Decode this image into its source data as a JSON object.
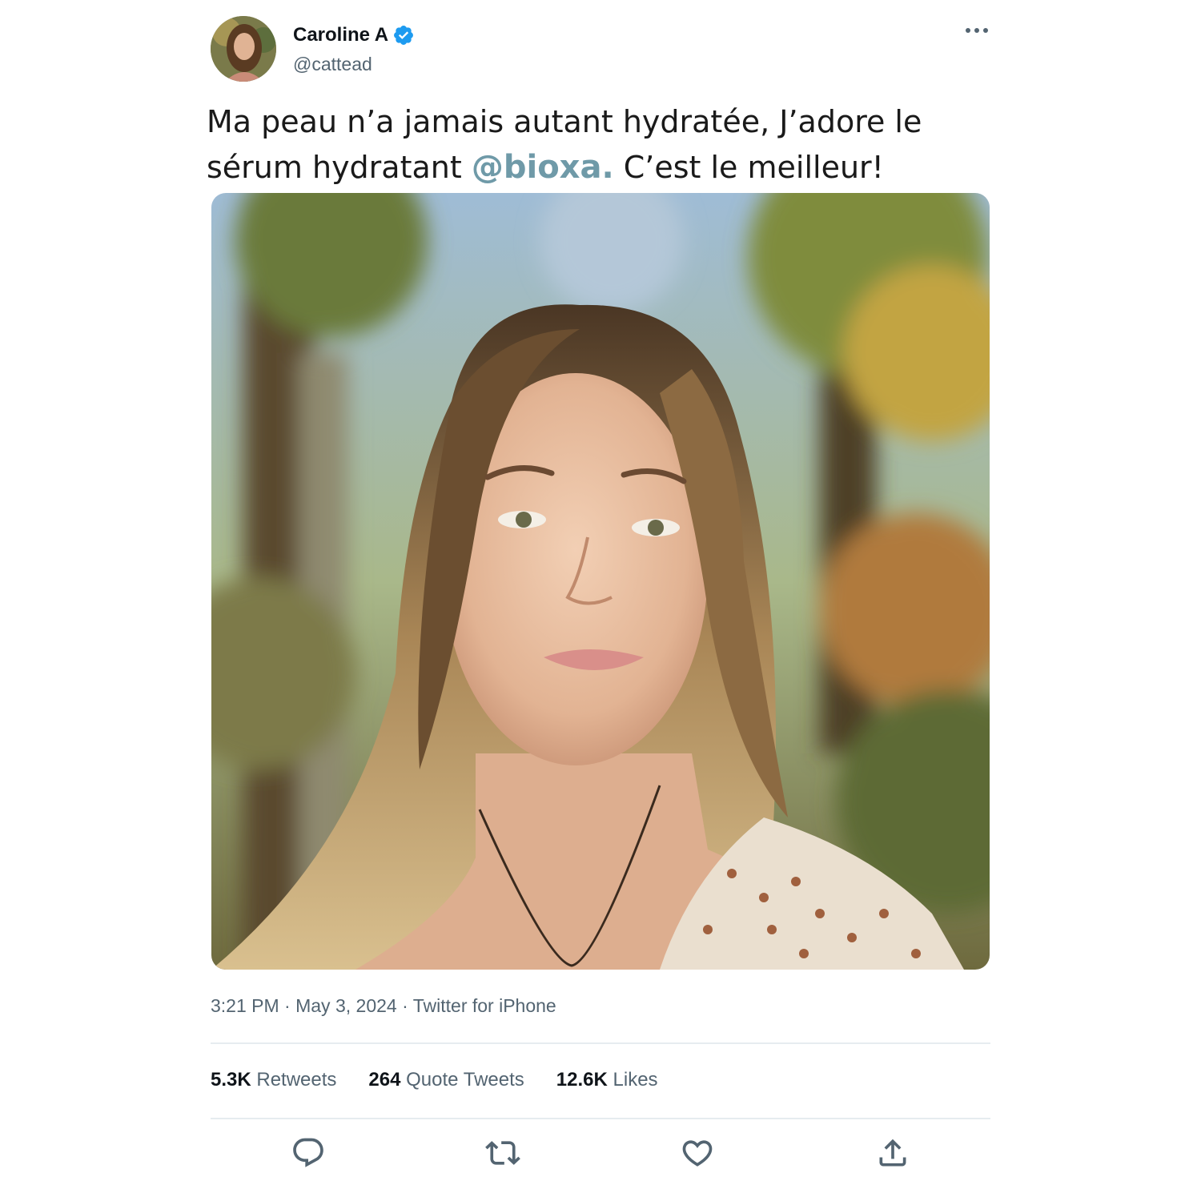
{
  "tweet": {
    "display_name": "Caroline A",
    "handle": "@cattead",
    "verified_icon": "verified-badge-icon",
    "more_icon": "more-options-icon",
    "text_before": "Ma peau n’a jamais autant hydratée, J’adore le sérum hydratant ",
    "mention": "@bioxa.",
    "text_after": " C’est le meilleur!",
    "media_description_icon": "photo",
    "time": "3:21 PM",
    "date": "May 3, 2024",
    "source": "Twitter for iPhone",
    "separator": "·"
  },
  "stats": {
    "retweets_count": "5.3K",
    "retweets_label": "Retweets",
    "quotes_count": "264",
    "quotes_label": "Quote Tweets",
    "likes_count": "12.6K",
    "likes_label": "Likes"
  },
  "actions": {
    "reply_icon": "reply-icon",
    "retweet_icon": "retweet-icon",
    "like_icon": "like-icon",
    "share_icon": "share-icon"
  },
  "colors": {
    "mention": "#6f9aa8",
    "verified": "#1d9bf0",
    "secondary_text": "#536471",
    "divider": "#e6ecf0"
  }
}
